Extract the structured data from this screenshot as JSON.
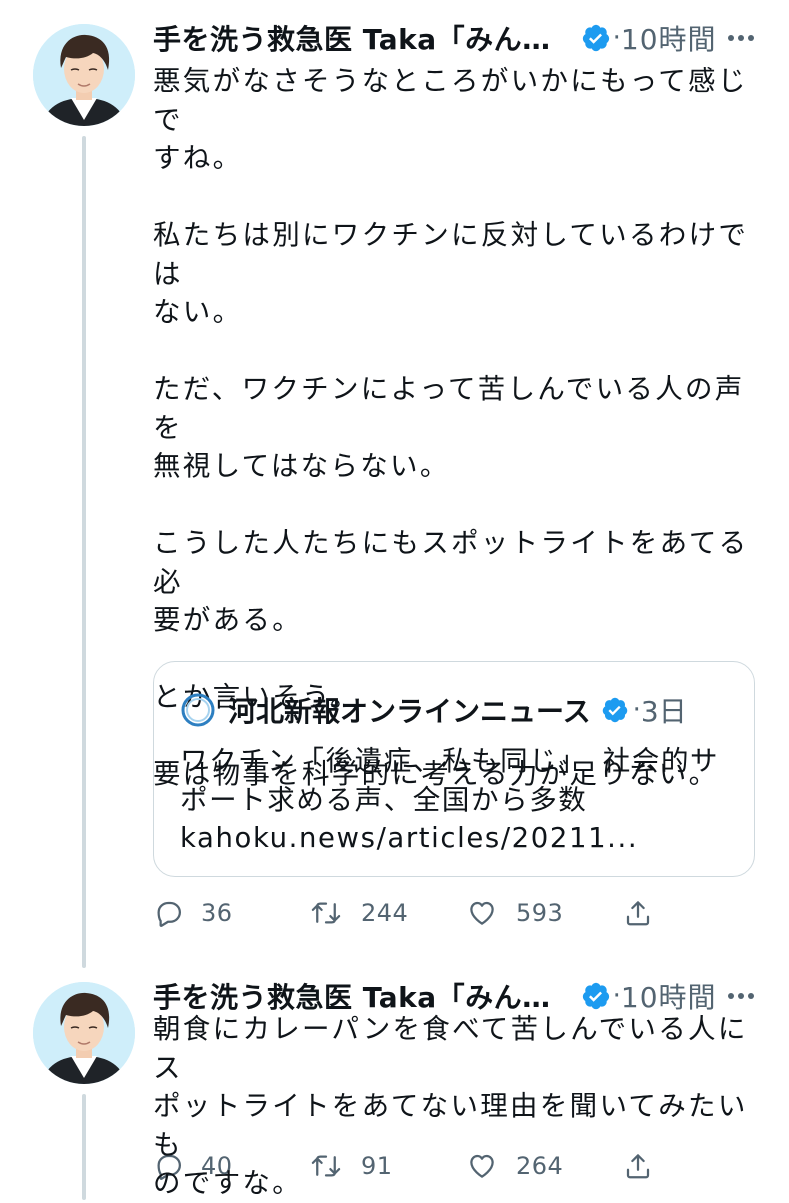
{
  "colors": {
    "text": "#0f1419",
    "secondary": "#536471",
    "verified": "#1d9bf0",
    "border": "#cfd9de",
    "avatar_bg": "#cfeefa"
  },
  "tweets": [
    {
      "author": {
        "display_name": "手を洗う救急医 Taka「みん…",
        "verified": true,
        "avatar_icon": "avatar-illustrated-man"
      },
      "separator": "·",
      "time": "10時間",
      "text": "悪気がなさそうなところがいかにもって感じで\nすね。\n\n私たちは別にワクチンに反対しているわけでは\nない。\n\nただ、ワクチンによって苦しんでいる人の声を\n無視してはならない。\n\nこうした人たちにもスポットライトをあてる必\n要がある。\n\nとか言いそう。\n\n要は物事を科学的に考える力が足りない。",
      "quote": {
        "author": "河北新報オンラインニュース",
        "verified": true,
        "logo_icon": "kahoku-logo-icon",
        "separator": "·",
        "time": "3日",
        "text": "ワクチン「後遺症、私も同じ」　社会的サ\nポート求める声、全国から多数\nkahoku.news/articles/20211..."
      },
      "stats": {
        "replies": "36",
        "retweets": "244",
        "likes": "593"
      }
    },
    {
      "author": {
        "display_name": "手を洗う救急医 Taka「みん…",
        "verified": true,
        "avatar_icon": "avatar-illustrated-man"
      },
      "separator": "·",
      "time": "10時間",
      "text": "朝食にカレーパンを食べて苦しんでいる人にス\nポットライトをあてない理由を聞いてみたいも\nのですな。",
      "stats": {
        "replies": "40",
        "retweets": "91",
        "likes": "264"
      }
    }
  ]
}
